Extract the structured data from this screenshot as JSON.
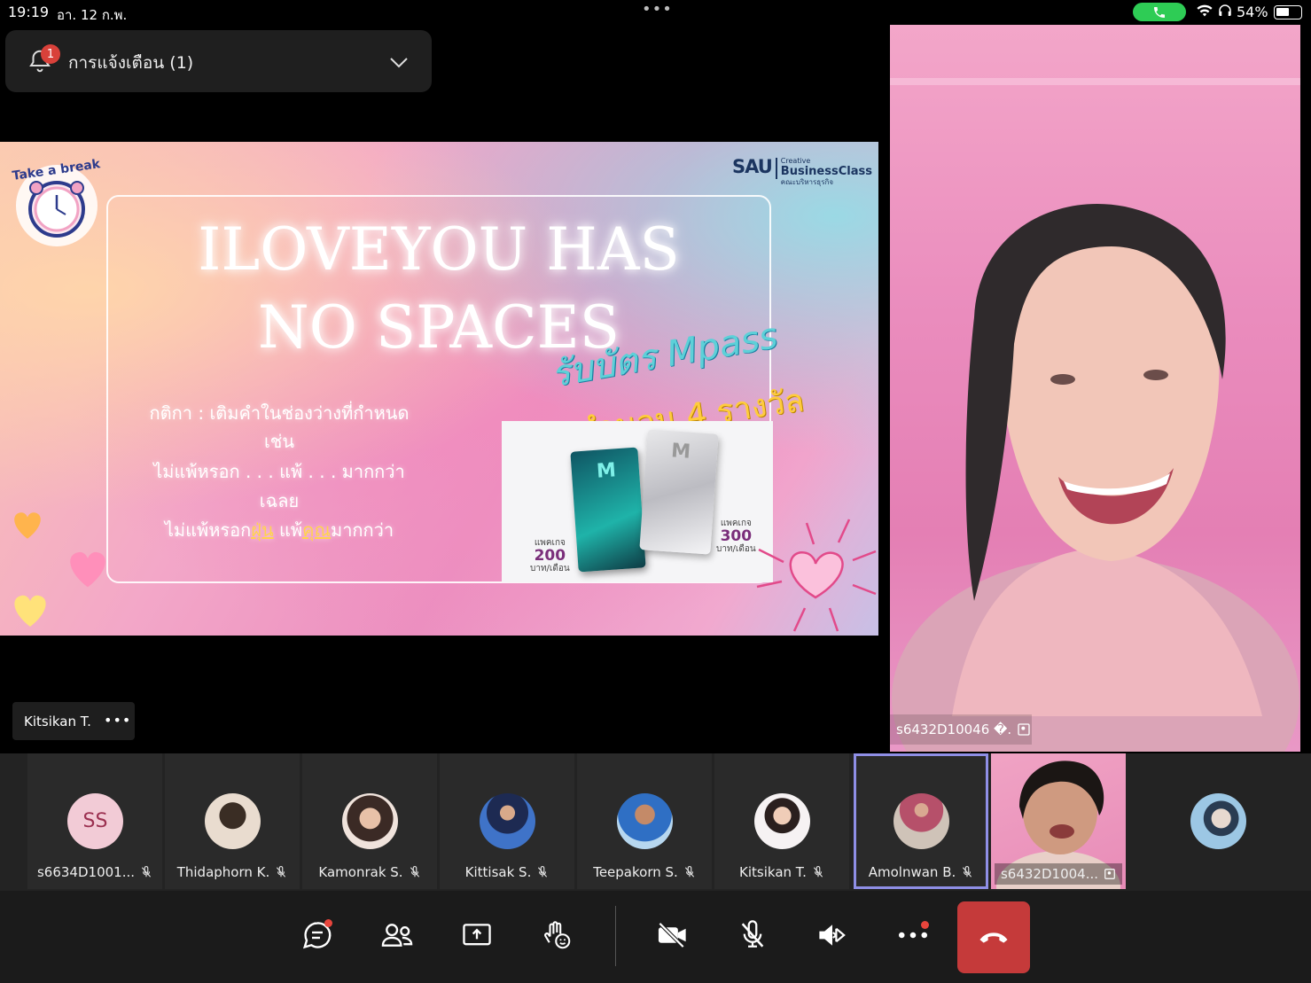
{
  "status_bar": {
    "time": "19:19",
    "date": "อา. 12 ก.พ.",
    "battery": "54%",
    "battery_level": 0.54,
    "call_color": "#2ecc55"
  },
  "notification": {
    "label": "การแจ้งเตือน (1)",
    "badge": "1"
  },
  "slide": {
    "title_line1": "ILOVEYOU HAS",
    "title_line2": "NO SPACES",
    "rule_line1": "กติกา  :  เติมคำในช่องว่างที่กำหนด",
    "rule_line2": "เช่น",
    "rule_line3": "ไม่แพ้หรอก . . . แพ้ . . . มากกว่า",
    "rule_line4": "เฉลย",
    "answer_prefix": "ไม่แพ้หรอก",
    "answer_word1": "ฝุ่น",
    "answer_mid": "  แพ้",
    "answer_word2": "คุณ",
    "answer_suffix": "มากกว่า",
    "promo_line1": "รับบัตร Mpass",
    "promo_line2": "จำนวน 4 รางวัล",
    "clock_caption": "Take a break",
    "logo_main": "SAU",
    "logo_right_top": "Creative",
    "logo_right_main": "BusinessClass",
    "logo_right_sub": "คณะบริหารธุรกิจ",
    "card_letter": "M",
    "price1_label": "แพคเกจ",
    "price1_value": "200",
    "price1_unit": "บาท/เดือน",
    "price2_label": "แพคเกจ",
    "price2_value": "300",
    "price2_unit": "บาท/เดือน"
  },
  "presenter": {
    "name": "Kitsikan T.",
    "more": "•••"
  },
  "main_video": {
    "name": "s6432D10046 �."
  },
  "participants": [
    {
      "name": "s6634D1001...",
      "initials": "SS",
      "muted": true
    },
    {
      "name": "Thidaphorn K.",
      "muted": true
    },
    {
      "name": "Kamonrak S.",
      "muted": true
    },
    {
      "name": "Kittisak S.",
      "muted": true
    },
    {
      "name": "Teepakorn S.",
      "muted": true
    },
    {
      "name": "Kitsikan T.",
      "muted": true
    },
    {
      "name": "Amolnwan B.",
      "muted": true,
      "active": true
    },
    {
      "name": "s6432D1004...",
      "video": true
    },
    {
      "name": ""
    }
  ],
  "controls": {
    "chat": "chat-icon",
    "people": "people-icon",
    "share": "share-screen-icon",
    "reactions": "raise-hand-icon",
    "camera": "camera-off-icon",
    "mic": "mic-off-icon",
    "speaker": "speaker-bluetooth-icon",
    "more": "more-icon",
    "hangup": "hang-up-icon",
    "hangup_color": "#c53a3a"
  }
}
